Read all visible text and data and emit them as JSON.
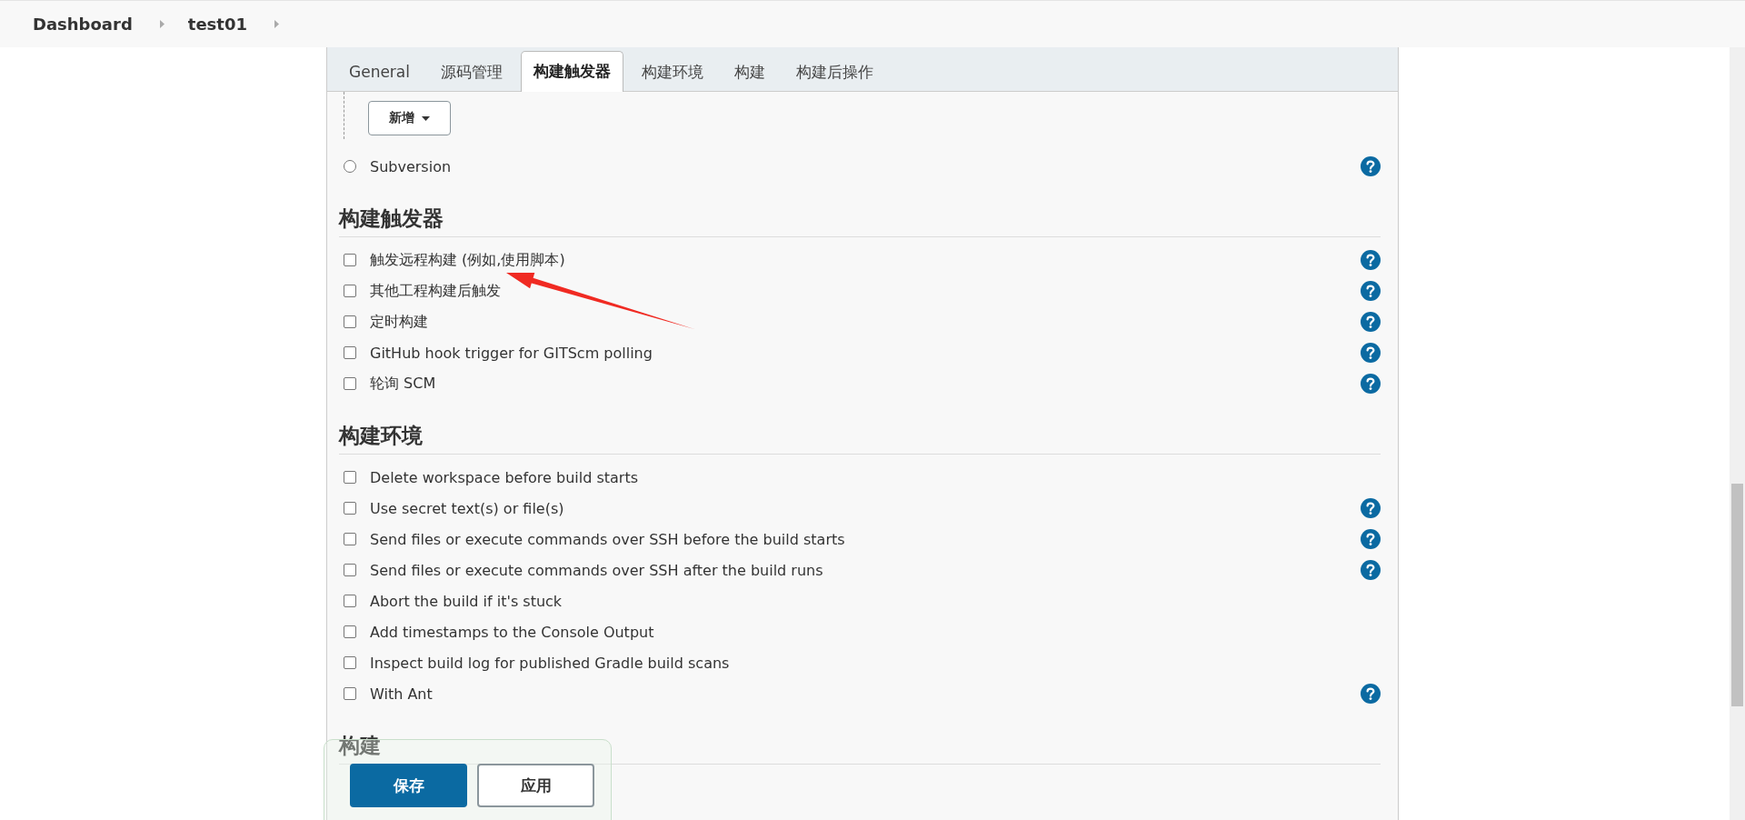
{
  "breadcrumb": [
    {
      "label": "Dashboard"
    },
    {
      "label": "test01"
    }
  ],
  "tabs": [
    {
      "label": "General",
      "selected": false
    },
    {
      "label": "源码管理",
      "selected": false
    },
    {
      "label": "构建触发器",
      "selected": true
    },
    {
      "label": "构建环境",
      "selected": false
    },
    {
      "label": "构建",
      "selected": false
    },
    {
      "label": "构建后操作",
      "selected": false
    }
  ],
  "scm": {
    "add_button": "新增",
    "options": [
      {
        "label": "Subversion",
        "selected": false,
        "help": true
      }
    ]
  },
  "sections": [
    {
      "title": "构建触发器",
      "items": [
        {
          "label": "触发远程构建 (例如,使用脚本)",
          "checked": false,
          "help": true
        },
        {
          "label": "其他工程构建后触发",
          "checked": false,
          "help": true
        },
        {
          "label": "定时构建",
          "checked": false,
          "help": true
        },
        {
          "label": "GitHub hook trigger for GITScm polling",
          "checked": false,
          "help": true
        },
        {
          "label": "轮询 SCM",
          "checked": false,
          "help": true
        }
      ]
    },
    {
      "title": "构建环境",
      "items": [
        {
          "label": "Delete workspace before build starts",
          "checked": false,
          "help": false
        },
        {
          "label": "Use secret text(s) or file(s)",
          "checked": false,
          "help": true
        },
        {
          "label": "Send files or execute commands over SSH before the build starts",
          "checked": false,
          "help": true
        },
        {
          "label": "Send files or execute commands over SSH after the build runs",
          "checked": false,
          "help": true
        },
        {
          "label": "Abort the build if it's stuck",
          "checked": false,
          "help": false
        },
        {
          "label": "Add timestamps to the Console Output",
          "checked": false,
          "help": false
        },
        {
          "label": "Inspect build log for published Gradle build scans",
          "checked": false,
          "help": false
        },
        {
          "label": "With Ant",
          "checked": false,
          "help": true
        }
      ]
    },
    {
      "title": "构建"
    }
  ],
  "footer": {
    "buttons": [
      {
        "label": "保存",
        "kind": "primary"
      },
      {
        "label": "应用",
        "kind": "secondary"
      }
    ]
  }
}
